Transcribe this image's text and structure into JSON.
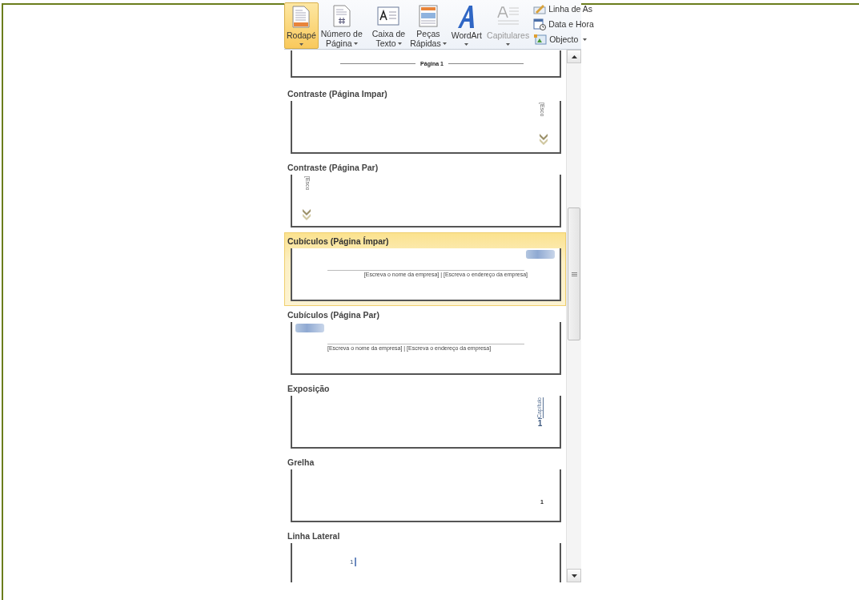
{
  "ribbon": {
    "large_buttons": [
      {
        "kind": "footer",
        "label": [
          "Rodapé"
        ],
        "dropdown": true,
        "selected": true,
        "disabled": false
      },
      {
        "kind": "page-number",
        "label": [
          "Número de",
          "Página"
        ],
        "dropdown": true,
        "selected": false,
        "disabled": false
      },
      {
        "kind": "text-box",
        "label": [
          "Caixa de",
          "Texto"
        ],
        "dropdown": true,
        "selected": false,
        "disabled": false
      },
      {
        "kind": "quick-parts",
        "label": [
          "Peças",
          "Rápidas"
        ],
        "dropdown": true,
        "selected": false,
        "disabled": false
      },
      {
        "kind": "wordart",
        "label": [
          "WordArt"
        ],
        "dropdown": true,
        "selected": false,
        "disabled": false
      },
      {
        "kind": "drop-cap",
        "label": [
          "Capitulares"
        ],
        "dropdown": true,
        "selected": false,
        "disabled": true
      }
    ],
    "small_buttons": [
      {
        "kind": "signature",
        "label": "Linha de As",
        "dropdown": false
      },
      {
        "kind": "date-time",
        "label": "Data e Hora",
        "dropdown": false
      },
      {
        "kind": "object",
        "label": "Objecto",
        "dropdown": true
      }
    ]
  },
  "gallery": {
    "items": [
      {
        "kind": "page-number-line",
        "preview_text": "Página 1",
        "selected": false
      },
      {
        "kind": "contrast-right",
        "label": "Contraste (Página Impar)",
        "preview_text": "[Esco",
        "selected": false
      },
      {
        "kind": "contrast-left",
        "label": "Contraste (Página Par)",
        "preview_text": "[Esco",
        "selected": false
      },
      {
        "kind": "cubicles-right",
        "label": "Cubículos (Página Ímpar)",
        "preview_text": "[Escreva o nome da empresa] | [Escreva o endereço da empresa]",
        "selected": true
      },
      {
        "kind": "cubicles-left",
        "label": "Cubículos (Página Par)",
        "preview_text": "[Escreva o nome da empresa] | [Escreva o endereço da empresa]",
        "selected": false
      },
      {
        "kind": "exposition",
        "label": "Exposição",
        "preview_caption": "Capítulo",
        "preview_text": "1",
        "selected": false
      },
      {
        "kind": "grid",
        "label": "Grelha",
        "preview_text": "1",
        "selected": false
      },
      {
        "kind": "sideline",
        "label": "Linha Lateral",
        "preview_text": "1",
        "selected": false
      }
    ]
  }
}
